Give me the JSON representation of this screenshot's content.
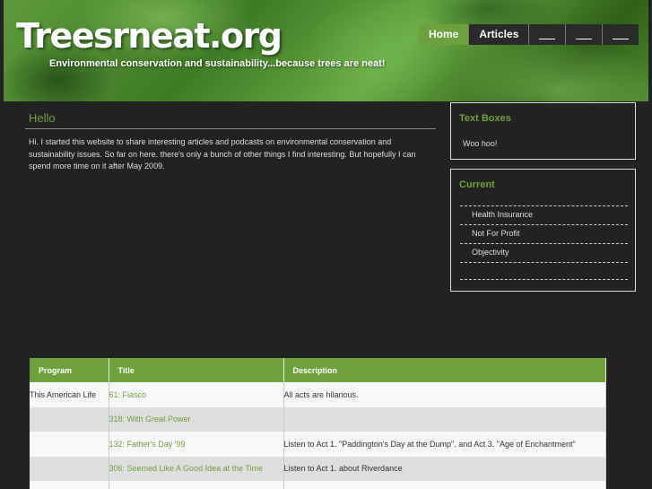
{
  "header": {
    "site_title": "Treesrneat.org",
    "tagline": "Environmental conservation and sustainability...because trees are neat!"
  },
  "nav": {
    "items": [
      {
        "label": "Home",
        "active": true
      },
      {
        "label": "Articles",
        "active": false
      },
      {
        "label": "",
        "active": false
      },
      {
        "label": "",
        "active": false
      },
      {
        "label": "",
        "active": false
      }
    ]
  },
  "main": {
    "heading": "Hello",
    "intro": "Hi. I started this website to share interesting articles and podcasts on environmental conservation and sustainability issues. So far on here. there's only a bunch of other things I find interesting. But hopefully I can spend more time on it after May 2009."
  },
  "sidebar": {
    "text_boxes": {
      "title": "Text Boxes",
      "body": "Woo hoo!"
    },
    "current": {
      "title": "Current",
      "items": [
        "Health Insurance",
        "Not For Profit",
        "Objectivity",
        ""
      ]
    }
  },
  "table": {
    "headers": [
      "Program",
      "Title",
      "Description"
    ],
    "rows": [
      {
        "program": "This American Life",
        "title": "61: Fiasco",
        "description": "All acts are hilarious."
      },
      {
        "program": "",
        "title": "318: With Great Power",
        "description": ""
      },
      {
        "program": "",
        "title": "132: Father's Day '99",
        "description": "Listen to Act 1. \"Paddington's Day at the Dump\". and Act 3. \"Age of Enchantment\""
      },
      {
        "program": "",
        "title": "306: Seemed Like A Good Idea at the Time",
        "description": "Listen to Act 1. about Riverdance"
      },
      {
        "program": "",
        "title": "",
        "description": ""
      }
    ]
  },
  "colors": {
    "accent": "#6ea03e",
    "background": "#222222",
    "text": "#dddddd"
  }
}
